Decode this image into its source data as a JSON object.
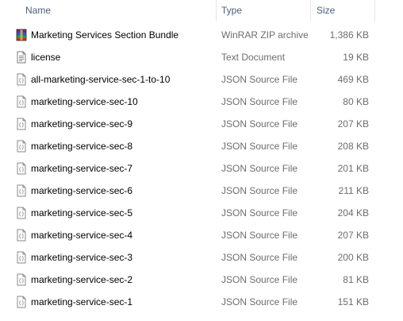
{
  "columns": {
    "name": "Name",
    "type": "Type",
    "size": "Size"
  },
  "files": [
    {
      "name": "Marketing Services Section Bundle",
      "type": "WinRAR ZIP archive",
      "size": "1,386 KB",
      "icon": "winrar-archive-icon"
    },
    {
      "name": "license",
      "type": "Text Document",
      "size": "19 KB",
      "icon": "text-document-icon"
    },
    {
      "name": "all-marketing-service-sec-1-to-10",
      "type": "JSON Source File",
      "size": "469 KB",
      "icon": "json-file-icon"
    },
    {
      "name": "marketing-service-sec-10",
      "type": "JSON Source File",
      "size": "80 KB",
      "icon": "json-file-icon"
    },
    {
      "name": "marketing-service-sec-9",
      "type": "JSON Source File",
      "size": "207 KB",
      "icon": "json-file-icon"
    },
    {
      "name": "marketing-service-sec-8",
      "type": "JSON Source File",
      "size": "208 KB",
      "icon": "json-file-icon"
    },
    {
      "name": "marketing-service-sec-7",
      "type": "JSON Source File",
      "size": "201 KB",
      "icon": "json-file-icon"
    },
    {
      "name": "marketing-service-sec-6",
      "type": "JSON Source File",
      "size": "211 KB",
      "icon": "json-file-icon"
    },
    {
      "name": "marketing-service-sec-5",
      "type": "JSON Source File",
      "size": "204 KB",
      "icon": "json-file-icon"
    },
    {
      "name": "marketing-service-sec-4",
      "type": "JSON Source File",
      "size": "207 KB",
      "icon": "json-file-icon"
    },
    {
      "name": "marketing-service-sec-3",
      "type": "JSON Source File",
      "size": "200 KB",
      "icon": "json-file-icon"
    },
    {
      "name": "marketing-service-sec-2",
      "type": "JSON Source File",
      "size": "81 KB",
      "icon": "json-file-icon"
    },
    {
      "name": "marketing-service-sec-1",
      "type": "JSON Source File",
      "size": "151 KB",
      "icon": "json-file-icon"
    }
  ]
}
